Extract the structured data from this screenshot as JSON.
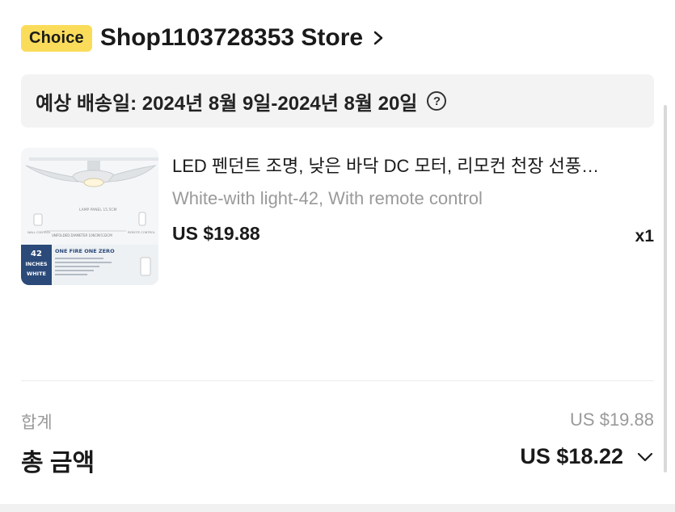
{
  "store": {
    "badge": "Choice",
    "name": "Shop1103728353 Store"
  },
  "delivery": {
    "text": "예상 배송일: 2024년 8월 9일-2024년 8월 20일",
    "help": "?"
  },
  "product": {
    "title": "LED 펜던트 조명, 낮은 바닥 DC 모터, 리모컨 천장 선풍…",
    "variant": "White-with light-42, With remote control",
    "price": "US $19.88",
    "qty": "x1",
    "image": {
      "lamp_panel": "LAMP PANEL 15.5CM",
      "diameter": "UNFOLDED DIAMETER 106CM/132CM",
      "wall_control": "WALL CONTROL",
      "remote_control": "REMOTE CONTROL",
      "size_badge_num": "42",
      "size_badge_unit": "INCHES",
      "size_badge_color": "WHITE",
      "brand": "ONE FIRE ONE ZERO"
    }
  },
  "totals": {
    "subtotal_label": "합계",
    "subtotal_value": "US $19.88",
    "total_label": "총 금액",
    "total_value": "US $18.22"
  },
  "colors": {
    "choice_badge": "#fbdc5a",
    "banner_bg": "#f3f3f3",
    "muted_text": "#9a9a9a"
  }
}
